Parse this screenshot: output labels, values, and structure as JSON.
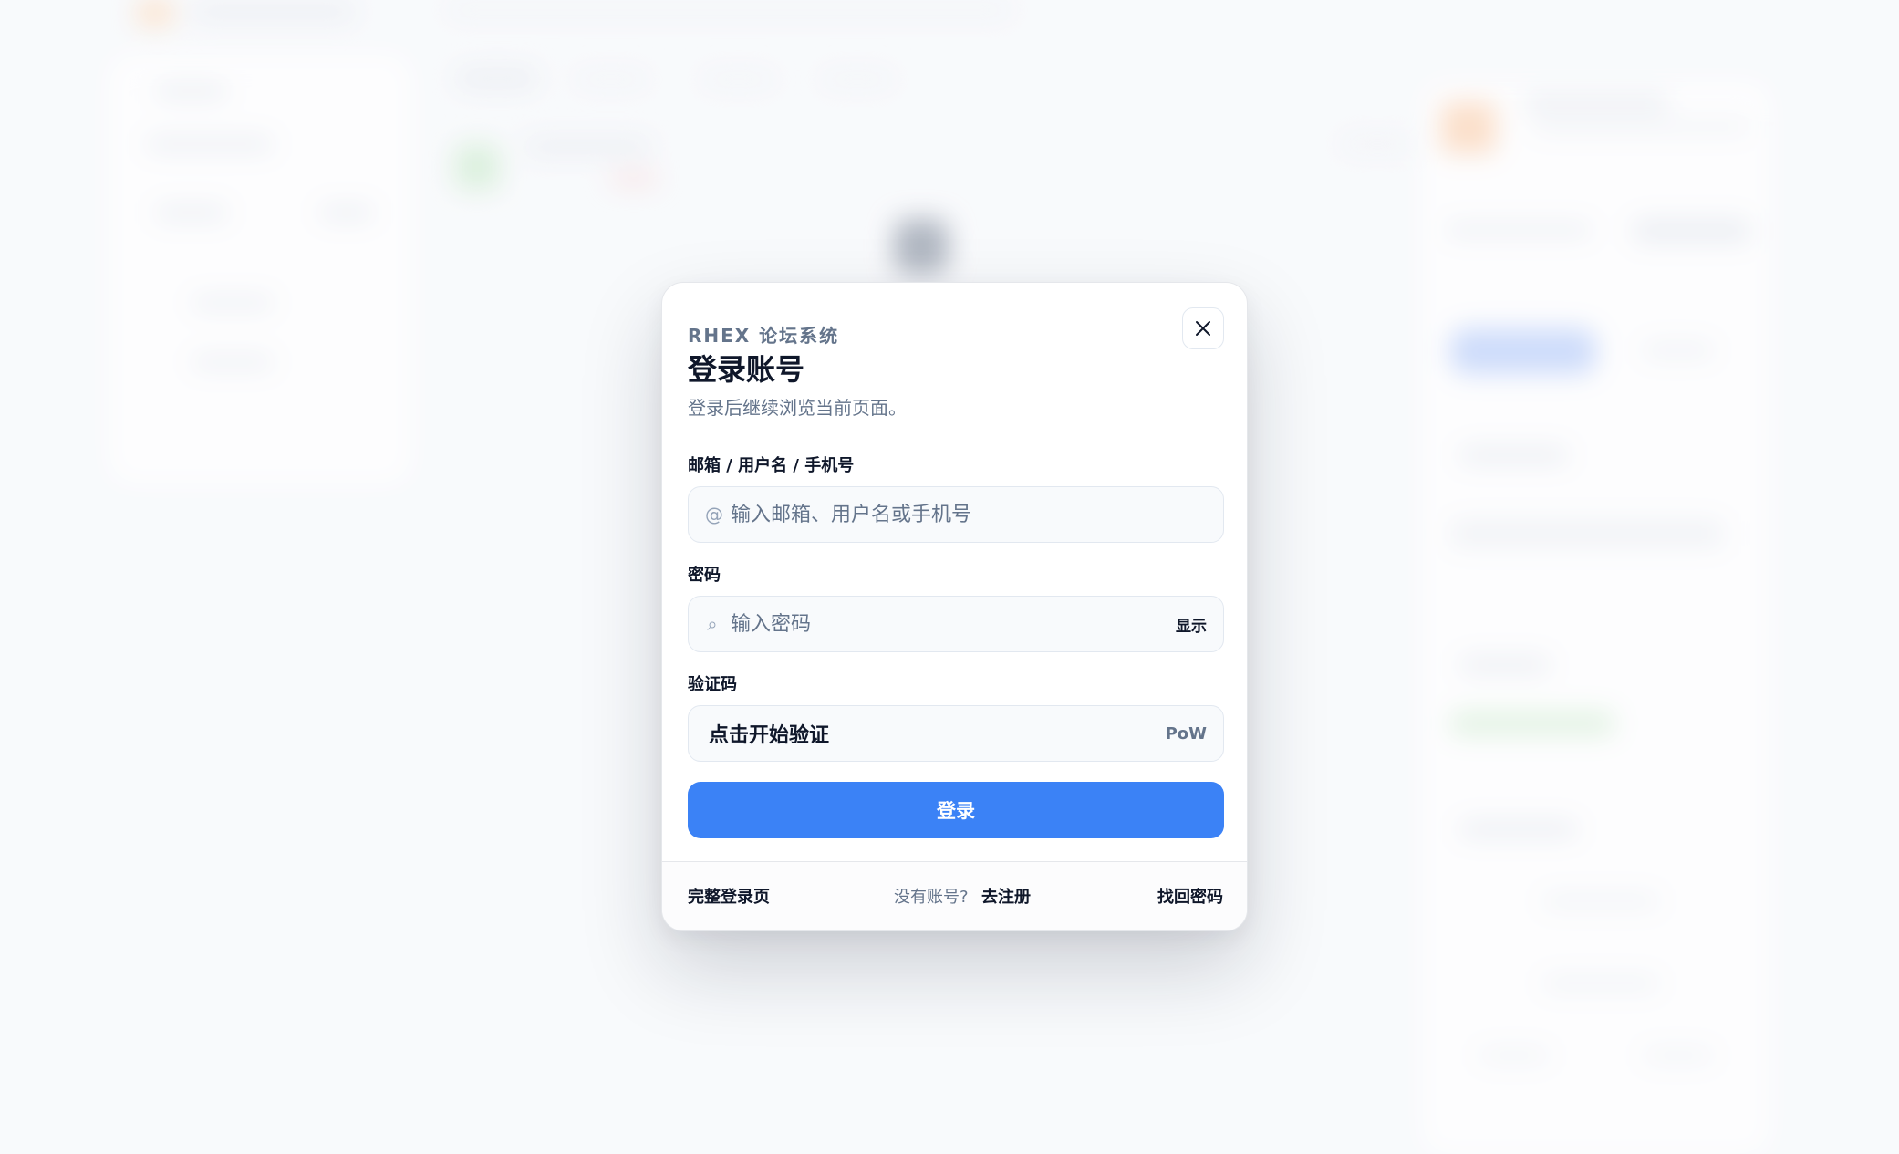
{
  "modal": {
    "brand": "RHEX 论坛系统",
    "title": "登录账号",
    "subtitle": "登录后继续浏览当前页面。",
    "close_icon": "close-icon"
  },
  "form": {
    "account": {
      "label": "邮箱 / 用户名 / 手机号",
      "icon": "@",
      "placeholder": "输入邮箱、用户名或手机号",
      "value": ""
    },
    "password": {
      "label": "密码",
      "icon": "⌕",
      "placeholder": "输入密码",
      "value": "",
      "toggle_label": "显示"
    },
    "captcha": {
      "label": "验证码",
      "button_label": "点击开始验证",
      "tag": "PoW"
    },
    "submit_label": "登录"
  },
  "footer": {
    "full_login_label": "完整登录页",
    "no_account_text": "没有账号?",
    "register_label": "去注册",
    "forgot_label": "找回密码"
  },
  "colors": {
    "primary": "#3b82f6",
    "text": "#0f172a",
    "muted": "#64748b",
    "background": "#f8fafc"
  }
}
